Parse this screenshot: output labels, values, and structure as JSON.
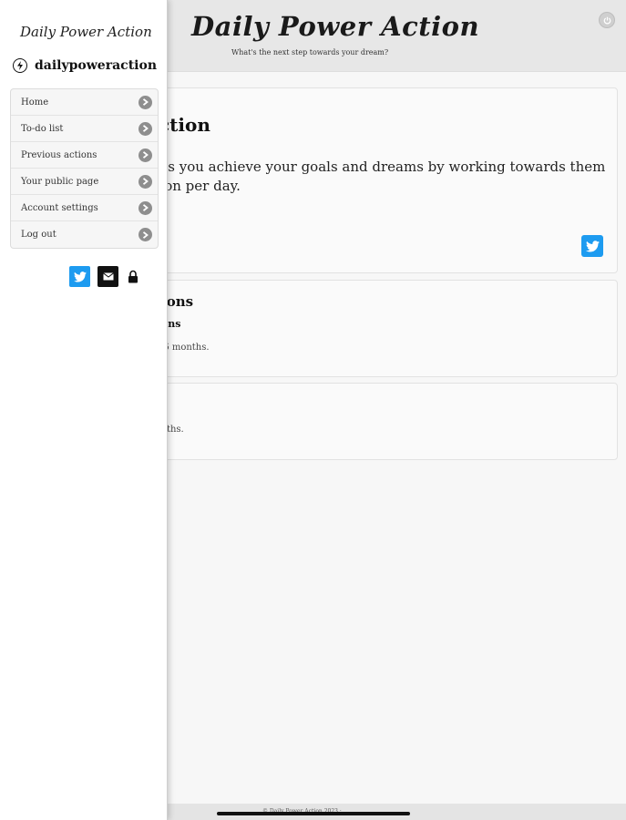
{
  "header": {
    "title": "Daily Power Action",
    "subtitle": "What's the next step towards your dream?"
  },
  "main": {
    "card1": {
      "heading": "action",
      "text": "elps you achieve your goals and dreams by working towards them ction per day."
    },
    "card2": {
      "heading": "ctions",
      "subheading": "ctions",
      "note": "ast 6 months."
    },
    "card3": {
      "note": "months."
    }
  },
  "footer": {
    "text": "© Daily Power Action 2023 · ..."
  },
  "drawer": {
    "brand": "Daily Power Action",
    "handle": "dailypoweraction",
    "menu": [
      {
        "label": "Home"
      },
      {
        "label": "To-do list"
      },
      {
        "label": "Previous actions"
      },
      {
        "label": "Your public page"
      },
      {
        "label": "Account settings"
      },
      {
        "label": "Log out"
      }
    ]
  },
  "icons": {
    "power": "power-icon",
    "twitter": "twitter-icon",
    "mail": "mail-icon",
    "lock": "lock-icon",
    "arrow": "chevron-right-icon"
  },
  "colors": {
    "twitter": "#1d9bf0",
    "header_bg": "#e7e7e7",
    "drawer_bg": "#ffffff"
  }
}
